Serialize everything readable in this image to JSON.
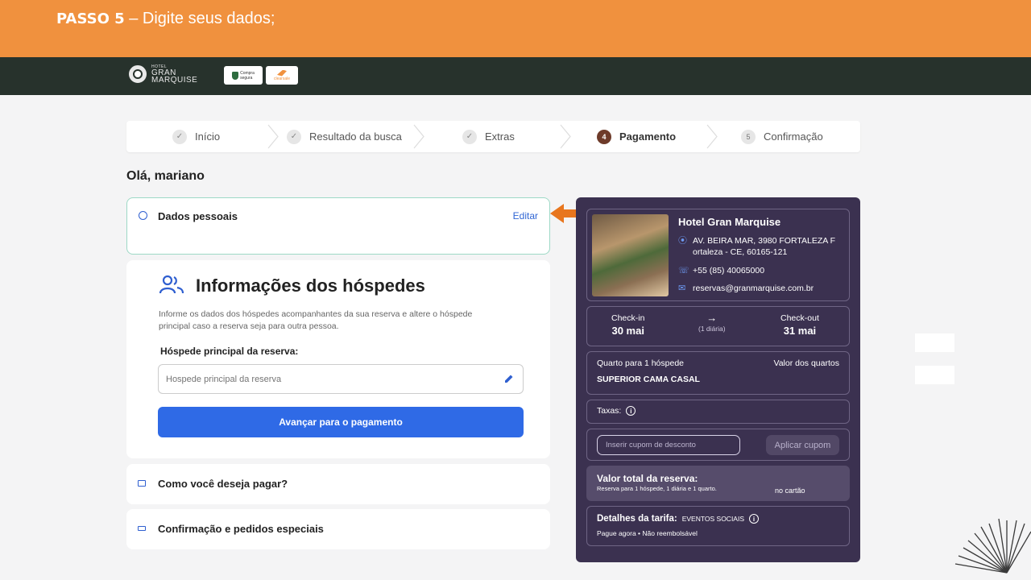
{
  "banner": {
    "step": "PASSO 5",
    "instruction": " – Digite seus dados;"
  },
  "header": {
    "logo_small": "HOTEL",
    "logo_line1": "GRAN",
    "logo_line2": "MARQUISE",
    "badge1_line1": "Compra",
    "badge1_line2": "segura",
    "badge2": "clearsale"
  },
  "steps": [
    {
      "label": "Início",
      "marker": "✓"
    },
    {
      "label": "Resultado da busca",
      "marker": "✓"
    },
    {
      "label": "Extras",
      "marker": "✓"
    },
    {
      "label": "Pagamento",
      "marker": "4"
    },
    {
      "label": "Confirmação",
      "marker": "5"
    }
  ],
  "greeting": "Olá, mariano",
  "dados": {
    "title": "Dados pessoais",
    "edit": "Editar"
  },
  "guests": {
    "title": "Informações dos hóspedes",
    "description": "Informe os dados dos hóspedes acompanhantes da sua reserva e altere o hóspede principal caso a reserva seja para outra pessoa.",
    "field_label": "Hóspede principal da reserva:",
    "field_placeholder": "Hospede principal da reserva",
    "submit": "Avançar para o pagamento"
  },
  "payment_section": "Como você deseja pagar?",
  "confirm_section": "Confirmação e pedidos especiais",
  "summary": {
    "hotel_name": "Hotel Gran Marquise",
    "address": "AV. BEIRA MAR, 3980 FORTALEZA F ortaleza - CE, 60165-121",
    "phone": "+55 (85) 40065000",
    "email": "reservas@granmarquise.com.br",
    "checkin_label": "Check-in",
    "checkin_date": "30 mai",
    "nights": "(1 diária)",
    "checkout_label": "Check-out",
    "checkout_date": "31 mai",
    "room_label": "Quarto para 1 hóspede",
    "room_type": "SUPERIOR CAMA CASAL",
    "room_value_label": "Valor dos quartos",
    "taxes_label": "Taxas:",
    "coupon_placeholder": "Inserir cupom de desconto",
    "coupon_button": "Aplicar cupom",
    "total_label": "Valor total da reserva:",
    "total_sub": "Reserva para 1 hóspede, 1 diária e 1 quarto.",
    "total_note": "no cartão",
    "tarifa_label": "Detalhes da tarifa:",
    "tarifa_tag": "EVENTOS SOCIAIS",
    "tarifa_policy": "Pague agora • Não reembolsável"
  },
  "colors": {
    "banner": "#f0913e",
    "topbar": "#27322c",
    "primary_button": "#2f6ae6",
    "summary_bg": "#3b3150",
    "active_step": "#6e3b2a"
  }
}
